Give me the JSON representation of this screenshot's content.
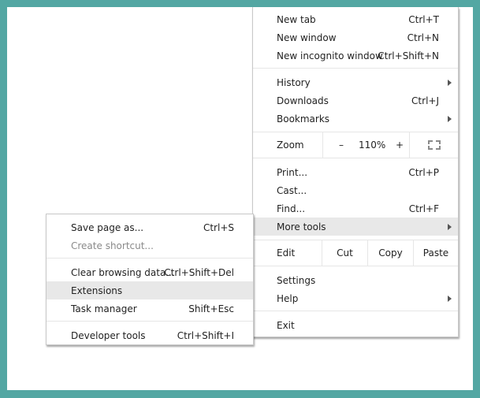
{
  "main_menu": {
    "new_tab": {
      "label": "New tab",
      "shortcut": "Ctrl+T"
    },
    "new_window": {
      "label": "New window",
      "shortcut": "Ctrl+N"
    },
    "new_incognito": {
      "label": "New incognito window",
      "shortcut": "Ctrl+Shift+N"
    },
    "history": {
      "label": "History"
    },
    "downloads": {
      "label": "Downloads",
      "shortcut": "Ctrl+J"
    },
    "bookmarks": {
      "label": "Bookmarks"
    },
    "zoom": {
      "label": "Zoom",
      "minus": "–",
      "value": "110%",
      "plus": "+",
      "fullscreen_icon": "fullscreen-icon"
    },
    "print": {
      "label": "Print...",
      "shortcut": "Ctrl+P"
    },
    "cast": {
      "label": "Cast..."
    },
    "find": {
      "label": "Find...",
      "shortcut": "Ctrl+F"
    },
    "more_tools": {
      "label": "More tools"
    },
    "edit": {
      "label": "Edit",
      "cut": "Cut",
      "copy": "Copy",
      "paste": "Paste"
    },
    "settings": {
      "label": "Settings"
    },
    "help": {
      "label": "Help"
    },
    "exit": {
      "label": "Exit"
    }
  },
  "submenu": {
    "save_page": {
      "label": "Save page as...",
      "shortcut": "Ctrl+S"
    },
    "create_shortcut": {
      "label": "Create shortcut..."
    },
    "clear_browsing": {
      "label": "Clear browsing data...",
      "shortcut": "Ctrl+Shift+Del"
    },
    "extensions": {
      "label": "Extensions"
    },
    "task_manager": {
      "label": "Task manager",
      "shortcut": "Shift+Esc"
    },
    "developer_tools": {
      "label": "Developer tools",
      "shortcut": "Ctrl+Shift+I"
    }
  },
  "colors": {
    "frame": "#53a7a3",
    "highlight": "#e8e8e8"
  }
}
